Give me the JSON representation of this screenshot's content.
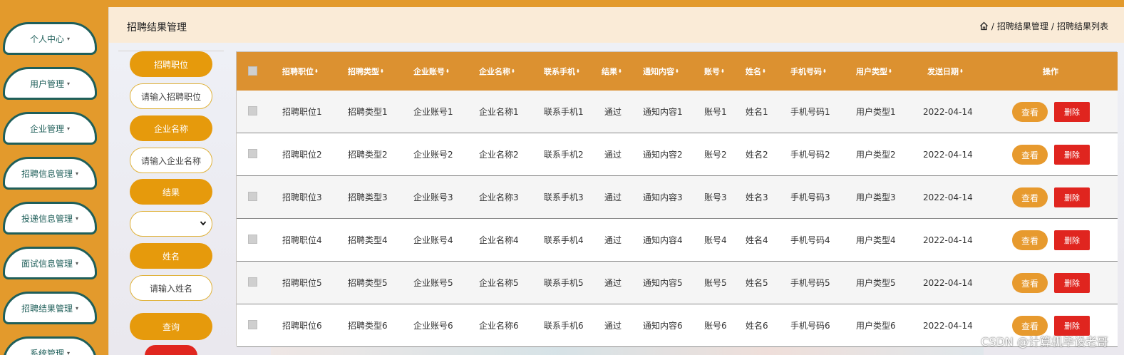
{
  "sidebar": {
    "items": [
      {
        "label": "个人中心"
      },
      {
        "label": "用户管理"
      },
      {
        "label": "企业管理"
      },
      {
        "label": "招聘信息管理"
      },
      {
        "label": "投递信息管理"
      },
      {
        "label": "面试信息管理"
      },
      {
        "label": "招聘结果管理"
      },
      {
        "label": "系统管理"
      }
    ],
    "caret": "▾"
  },
  "header": {
    "title": "招聘结果管理",
    "breadcrumb": [
      "招聘结果管理",
      "招聘结果列表"
    ],
    "separator": "/"
  },
  "filters": {
    "position_label": "招聘职位",
    "position_placeholder": "请输入招聘职位",
    "company_label": "企业名称",
    "company_placeholder": "请输入企业名称",
    "result_label": "结果",
    "result_value": "",
    "name_label": "姓名",
    "name_placeholder": "请输入姓名",
    "search_label": "查询"
  },
  "table": {
    "columns": [
      "招聘职位",
      "招聘类型",
      "企业账号",
      "企业名称",
      "联系手机",
      "结果",
      "通知内容",
      "账号",
      "姓名",
      "手机号码",
      "用户类型",
      "发送日期",
      "操作"
    ],
    "rows": [
      [
        "招聘职位1",
        "招聘类型1",
        "企业账号1",
        "企业名称1",
        "联系手机1",
        "通过",
        "通知内容1",
        "账号1",
        "姓名1",
        "手机号码1",
        "用户类型1",
        "2022-04-14"
      ],
      [
        "招聘职位2",
        "招聘类型2",
        "企业账号2",
        "企业名称2",
        "联系手机2",
        "通过",
        "通知内容2",
        "账号2",
        "姓名2",
        "手机号码2",
        "用户类型2",
        "2022-04-14"
      ],
      [
        "招聘职位3",
        "招聘类型3",
        "企业账号3",
        "企业名称3",
        "联系手机3",
        "通过",
        "通知内容3",
        "账号3",
        "姓名3",
        "手机号码3",
        "用户类型3",
        "2022-04-14"
      ],
      [
        "招聘职位4",
        "招聘类型4",
        "企业账号4",
        "企业名称4",
        "联系手机4",
        "通过",
        "通知内容4",
        "账号4",
        "姓名4",
        "手机号码4",
        "用户类型4",
        "2022-04-14"
      ],
      [
        "招聘职位5",
        "招聘类型5",
        "企业账号5",
        "企业名称5",
        "联系手机5",
        "通过",
        "通知内容5",
        "账号5",
        "姓名5",
        "手机号码5",
        "用户类型5",
        "2022-04-14"
      ],
      [
        "招聘职位6",
        "招聘类型6",
        "企业账号6",
        "企业名称6",
        "联系手机6",
        "通过",
        "通知内容6",
        "账号6",
        "姓名6",
        "手机号码6",
        "用户类型6",
        "2022-04-14"
      ]
    ],
    "view_label": "查看",
    "delete_label": "删除",
    "sort_glyph": "⬍"
  },
  "watermark": "CSDN @计算机毕设老哥",
  "colors": {
    "primary": "#e39a2c",
    "header_bg": "#faebd7",
    "danger": "#e0251f",
    "nav_border": "#1f5f5a"
  }
}
